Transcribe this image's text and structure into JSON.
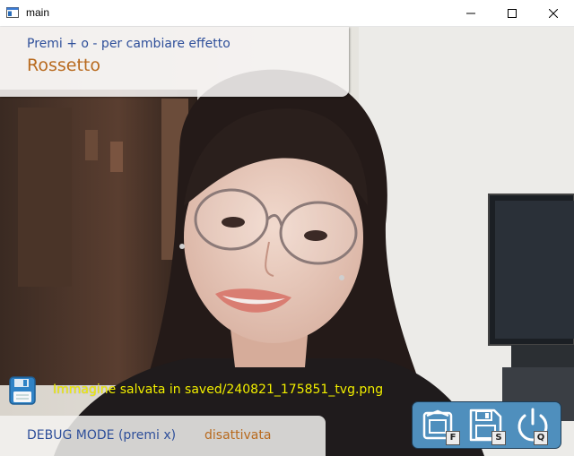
{
  "window": {
    "title": "main"
  },
  "effect": {
    "hint": "Premi + o - per cambiare effetto",
    "name": "Rossetto"
  },
  "save_status": {
    "message": "Immagine salvata in saved/240821_175851_tvg.png"
  },
  "debug": {
    "label": "DEBUG MODE (premi x)",
    "state": "disattivata"
  },
  "toolbar": {
    "fullscreen_key": "F",
    "save_key": "S",
    "quit_key": "Q"
  },
  "colors": {
    "hint_text": "#2e4f9a",
    "accent_text": "#b86a1e",
    "save_message": "#f3f000",
    "toolbar_bg": "#4f8fbd"
  }
}
